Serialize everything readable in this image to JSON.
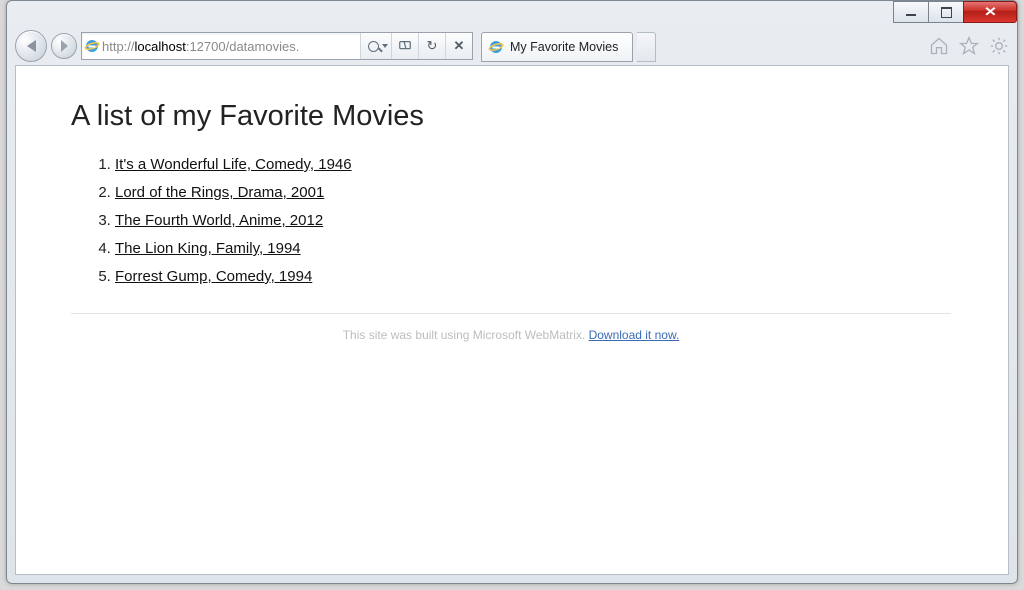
{
  "window": {
    "min_tip": "Minimize",
    "max_tip": "Maximize",
    "close_tip": "Close"
  },
  "toolbar": {
    "back_tip": "Back",
    "forward_tip": "Forward",
    "url_host": "localhost",
    "url_prefix": "http://",
    "url_port_path": ":12700/datamovies.",
    "search_tip": "Search",
    "compat_tip": "Compatibility View",
    "refresh_tip": "Refresh",
    "refresh_glyph": "↻",
    "stop_tip": "Stop",
    "stop_glyph": "✕"
  },
  "tab": {
    "title": "My Favorite Movies"
  },
  "chrome_icons": {
    "home_tip": "Home",
    "favorites_tip": "Favorites",
    "tools_tip": "Tools"
  },
  "page": {
    "heading": "A list of my Favorite Movies",
    "movies": [
      "It's a Wonderful Life, Comedy, 1946",
      "Lord of the Rings, Drama, 2001",
      "The Fourth World, Anime, 2012",
      "The Lion King, Family, 1994",
      "Forrest Gump, Comedy, 1994"
    ],
    "footer_text": "This site was built using Microsoft WebMatrix. ",
    "footer_link": "Download it now."
  }
}
